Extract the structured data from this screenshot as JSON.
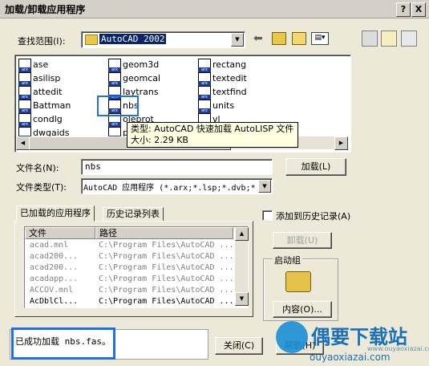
{
  "window": {
    "title": "加载/卸载应用程序",
    "help_btn": "?",
    "close_btn": "X"
  },
  "lookin": {
    "label": "查找范围(I):",
    "value": "AutoCAD 2002"
  },
  "files": [
    {
      "name": "ase"
    },
    {
      "name": "asilisp"
    },
    {
      "name": "attedit"
    },
    {
      "name": "Battman"
    },
    {
      "name": "condlg"
    },
    {
      "name": "dwgaids"
    },
    {
      "name": "geom3d"
    },
    {
      "name": "geomcal"
    },
    {
      "name": "laytrans"
    },
    {
      "name": "nbs"
    },
    {
      "name": "oleprot"
    },
    {
      "name": "pl"
    },
    {
      "name": "rectang"
    },
    {
      "name": "textedit"
    },
    {
      "name": "textfind"
    },
    {
      "name": "units"
    },
    {
      "name": "vl"
    },
    {
      "name": ""
    }
  ],
  "tooltip": {
    "line1": "类型: AutoCAD 快速加载 AutoLISP 文件",
    "line2": "大小: 2.29 KB"
  },
  "filename": {
    "label": "文件名(N):",
    "value": "nbs"
  },
  "filetype": {
    "label": "文件类型(T):",
    "value": "AutoCAD 应用程序 (*.arx;*.lsp;*.dvb;*"
  },
  "buttons": {
    "load": "加载(L)",
    "unload": "卸载(U)",
    "contents": "内容(O)...",
    "close": "关闭(C)",
    "help": "帮助(H)"
  },
  "tabs": {
    "loaded": "已加载的应用程序",
    "history": "历史记录列表"
  },
  "history_check": "添加到历史记录(A)",
  "startup_group": "启动组",
  "grid": {
    "headers": [
      "文件",
      "路径"
    ],
    "rows": [
      {
        "file": "acad.mnl",
        "path": "C:\\Program Files\\AutoCAD ...",
        "dim": true
      },
      {
        "file": "acad200...",
        "path": "C:\\Program Files\\AutoCAD ...",
        "dim": true
      },
      {
        "file": "acad200...",
        "path": "C:\\Program Files\\AutoCAD ...",
        "dim": true
      },
      {
        "file": "acadapp...",
        "path": "C:\\Program Files\\AutoCAD ...",
        "dim": true
      },
      {
        "file": "ACCOV.mnl",
        "path": "C:\\Program Files\\AutoCAD ...",
        "dim": true
      },
      {
        "file": "AcDblCl...",
        "path": "C:\\Program Files\\AutoCAD ...",
        "dim": false
      }
    ]
  },
  "status": "已成功加载 nbs.fas。",
  "watermark": {
    "title": "偶要下载站",
    "url1": "www.ouyaoxiazai.com",
    "url2": "ouyaoxiazai.com"
  },
  "colors": {
    "highlight": "#1f6feb",
    "selection": "#0a246a",
    "tooltip_bg": "#ffffe1"
  }
}
